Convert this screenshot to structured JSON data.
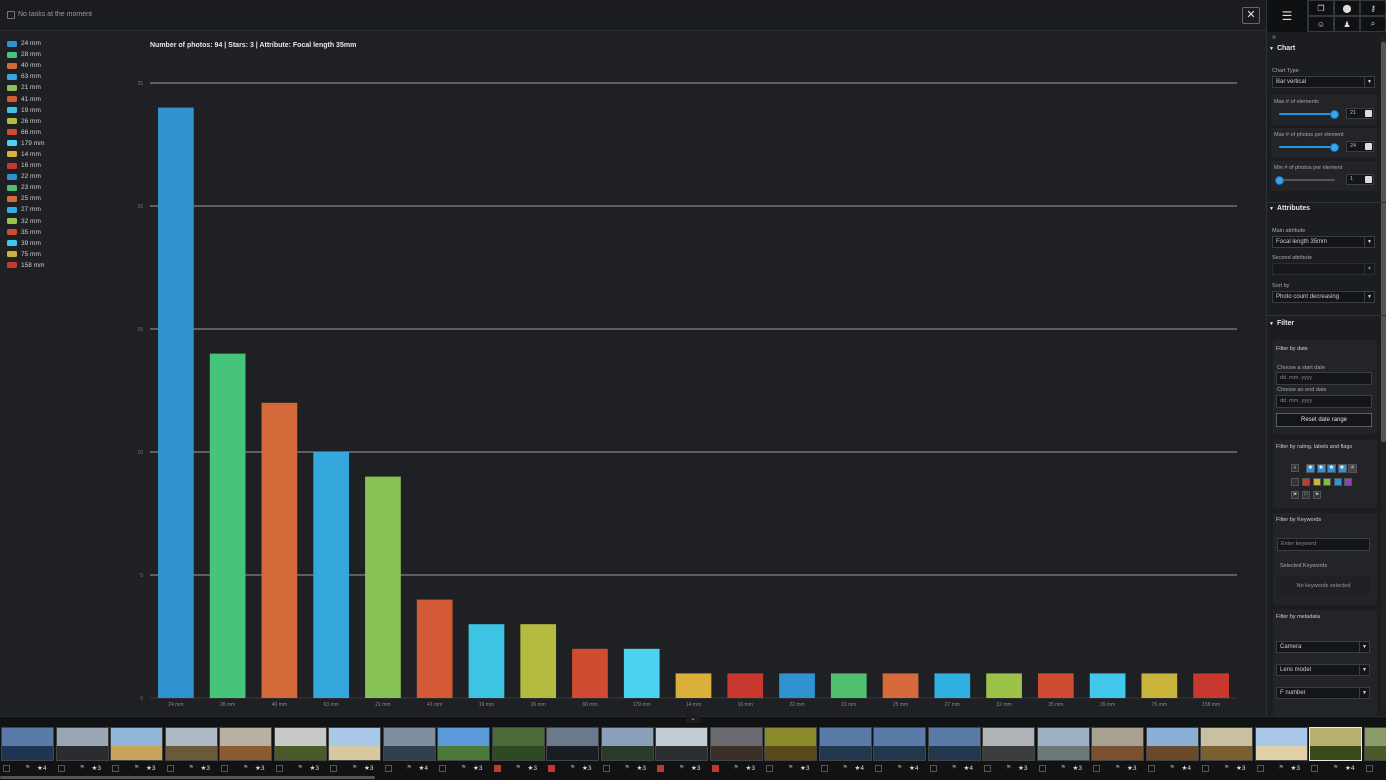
{
  "topbar": {
    "task_text": "No tasks at the moment",
    "close_label": "✕"
  },
  "chart_data": {
    "type": "bar",
    "title": "Number of photos: 94 | Stars: 3 | Attribute: Focal length 35mm",
    "categories": [
      "24 mm",
      "28 mm",
      "40 mm",
      "63 mm",
      "21 mm",
      "41 mm",
      "19 mm",
      "26 mm",
      "66 mm",
      "179 mm",
      "14 mm",
      "16 mm",
      "22 mm",
      "23 mm",
      "25 mm",
      "27 mm",
      "32 mm",
      "35 mm",
      "39 mm",
      "75 mm",
      "158 mm"
    ],
    "values": [
      24,
      14,
      12,
      10,
      9,
      4,
      3,
      3,
      2,
      2,
      1,
      1,
      1,
      1,
      1,
      1,
      1,
      1,
      1,
      1,
      1
    ],
    "colors": [
      "#2e93d0",
      "#46c47a",
      "#d4693a",
      "#34a8dc",
      "#86c254",
      "#d45a35",
      "#3cc4e2",
      "#b3bc3e",
      "#cf4b32",
      "#4ad2f0",
      "#d9b13a",
      "#c9382f",
      "#2e93d0",
      "#50c070",
      "#d76a3a",
      "#2fb0e0",
      "#9cc24a",
      "#cf4b32",
      "#42c8ec",
      "#c9b33a",
      "#c9382f"
    ],
    "ylim": [
      0,
      25
    ],
    "yticks": [
      0,
      5,
      10,
      15,
      20,
      25
    ],
    "grid": true,
    "legend": "top-left"
  },
  "panel": {
    "tools": {
      "main_icon": "edit-list-icon",
      "icons": [
        "copy-icon",
        "location-icon",
        "key-icon",
        "face-icon",
        "people-icon",
        "search-icon"
      ]
    },
    "expand_label": "»",
    "chart": {
      "heading": "Chart",
      "chart_type_label": "Chart Type",
      "chart_type_value": "Bar vertical",
      "max_elements_label": "Max # of elements",
      "max_elements_value": "21",
      "max_elements_level": 1.0,
      "max_photos_label": "Max # of photos per element",
      "max_photos_value": "24",
      "max_photos_level": 1.0,
      "min_photos_label": "Min # of photos per element",
      "min_photos_value": "1",
      "min_photos_level": 0.0
    },
    "attributes": {
      "heading": "Attributes",
      "main_label": "Main attribute",
      "main_value": "Focal length 35mm",
      "second_label": "Second attribute",
      "second_value": "",
      "sort_label": "Sort by",
      "sort_value": "Photo count decreasing"
    },
    "filter": {
      "heading": "Filter",
      "date": {
        "title": "Filter by date",
        "start_label": "Choose a start date",
        "start_placeholder": "dd. mm. yyyy",
        "end_label": "Choose an end date",
        "end_placeholder": "dd. mm. yyyy",
        "reset_label": "Reset date range"
      },
      "rating": {
        "title": "Filter by rating, labels and flags",
        "stars_on": 4,
        "label_colors": [
          "#c0392b",
          "#d4b13a",
          "#7cc042",
          "#2e93d0",
          "#8e44ad"
        ]
      },
      "keywords": {
        "title": "Filter by Keywords",
        "placeholder": "Enter keyword",
        "selected_label": "Selected Keywords",
        "empty_label": "No keywords selected"
      },
      "metadata": {
        "title": "Filter by metadata",
        "camera": "Camera",
        "lens": "Lens model",
        "fnumber": "F number"
      }
    }
  },
  "filmstrip": {
    "toggle": "⌄",
    "thumbs": [
      {
        "sky": "#5a7aa8",
        "ground": "#1f3554",
        "rating": "★4",
        "red": false
      },
      {
        "sky": "#9aa6b4",
        "ground": "#2a2c30",
        "rating": "★3",
        "red": false
      },
      {
        "sky": "#8fb5d8",
        "ground": "#c8a45a",
        "rating": "★3",
        "red": false
      },
      {
        "sky": "#aeb9c5",
        "ground": "#6a5a3a",
        "rating": "★3",
        "red": false
      },
      {
        "sky": "#b8b0a0",
        "ground": "#8a5a30",
        "rating": "★3",
        "red": false
      },
      {
        "sky": "#c7c9c8",
        "ground": "#4a5a2a",
        "rating": "★3",
        "red": false
      },
      {
        "sky": "#a8c8e8",
        "ground": "#d8c8a0",
        "rating": "★3",
        "red": false
      },
      {
        "sky": "#7e8e9e",
        "ground": "#30404e",
        "rating": "★4",
        "red": false
      },
      {
        "sky": "#5b9ad8",
        "ground": "#4a7a3a",
        "rating": "★3",
        "red": false
      },
      {
        "sky": "#4a6a3a",
        "ground": "#2e4a22",
        "rating": "★3",
        "red": true
      },
      {
        "sky": "#6a7a8a",
        "ground": "#1a1e22",
        "rating": "★3",
        "red": true
      },
      {
        "sky": "#8aa0b8",
        "ground": "#2a3a2a",
        "rating": "★3",
        "red": false
      },
      {
        "sky": "#c4ccd4",
        "ground": "#2a2e30",
        "rating": "★3",
        "red": true
      },
      {
        "sky": "#6a6a70",
        "ground": "#3a2e26",
        "rating": "★3",
        "red": true
      },
      {
        "sky": "#8a8a2a",
        "ground": "#5a4a1a",
        "rating": "★3",
        "red": false
      },
      {
        "sky": "#5a7aa8",
        "ground": "#22364e",
        "rating": "★4",
        "red": false
      },
      {
        "sky": "#5a7aa8",
        "ground": "#22364e",
        "rating": "★4",
        "red": false
      },
      {
        "sky": "#5a7aa8",
        "ground": "#22364e",
        "rating": "★4",
        "red": false
      },
      {
        "sky": "#b0b4b8",
        "ground": "#3a3c3e",
        "rating": "★3",
        "red": false
      },
      {
        "sky": "#9eb0c4",
        "ground": "#6a7a7a",
        "rating": "★3",
        "red": false
      },
      {
        "sky": "#a8a090",
        "ground": "#7a5030",
        "rating": "★3",
        "red": false
      },
      {
        "sky": "#8ab0d8",
        "ground": "#6a4a2a",
        "rating": "★4",
        "red": false
      },
      {
        "sky": "#c8c0a0",
        "ground": "#7a6030",
        "rating": "★3",
        "red": false
      },
      {
        "sky": "#a8c8e8",
        "ground": "#e0d0a8",
        "rating": "★3",
        "red": false
      },
      {
        "sky": "#b8b070",
        "ground": "#3a4a1a",
        "rating": "★4",
        "red": false
      },
      {
        "sky": "#8a9a6a",
        "ground": "#4a5a2a",
        "rating": "★3",
        "red": false
      }
    ]
  }
}
